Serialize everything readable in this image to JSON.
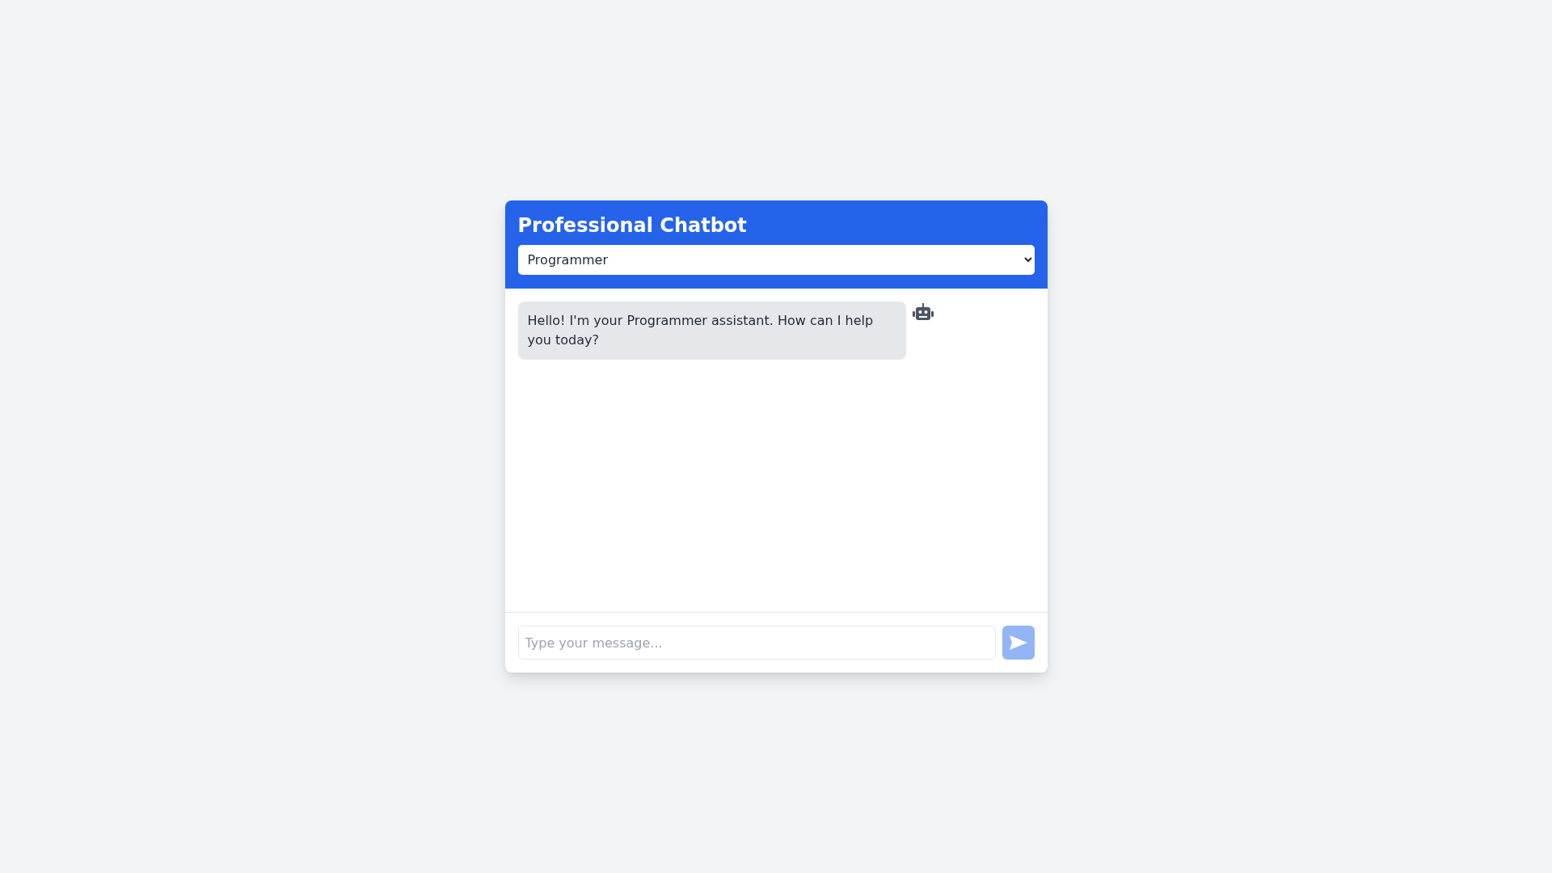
{
  "header": {
    "title": "Professional Chatbot",
    "role_select": {
      "value": "Programmer"
    }
  },
  "messages": [
    {
      "kind": "bot",
      "text": "Hello! I'm your Programmer assistant. How can I help you today?"
    }
  ],
  "composer": {
    "placeholder": "Type your message...",
    "send_disabled": true
  }
}
